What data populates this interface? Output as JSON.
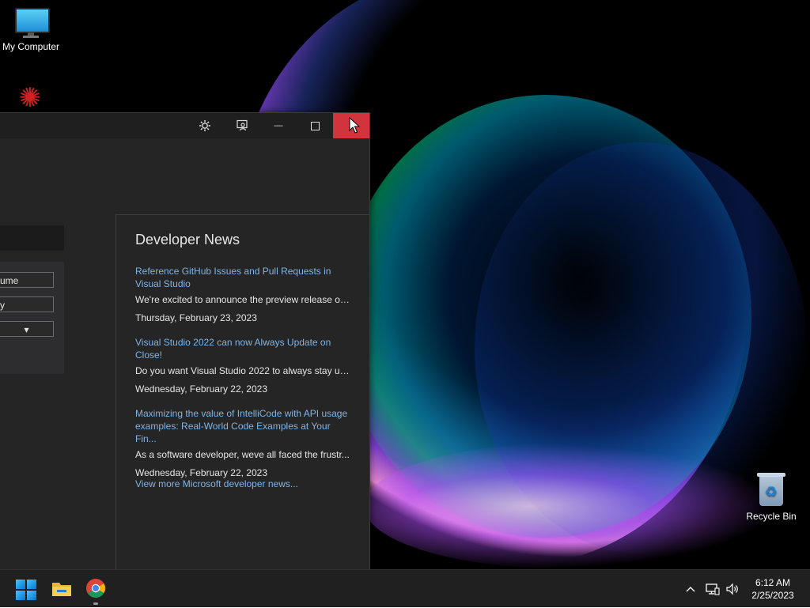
{
  "desktop": {
    "icons": [
      {
        "label": "My Computer"
      },
      {
        "label": "Recycle Bin"
      }
    ]
  },
  "window": {
    "titlebar": {
      "settings_icon": "gear-icon",
      "feedback_icon": "feedback-person-icon",
      "minimize_glyph": "—",
      "maximize_glyph": "☐",
      "close_glyph": "✕"
    },
    "left_pane": {
      "fields": [
        "sume",
        "ify",
        "▾"
      ]
    },
    "news": {
      "title": "Developer News",
      "items": [
        {
          "link": "Reference GitHub Issues and Pull Requests in Visual Studio",
          "snippet": "We're excited to announce the preview release of...",
          "date": "Thursday, February 23, 2023"
        },
        {
          "link": "Visual Studio 2022 can now Always Update on Close!",
          "snippet": "Do you want Visual Studio 2022 to always stay up...",
          "date": "Wednesday, February 22, 2023"
        },
        {
          "link": "Maximizing the value of IntelliCode with API usage examples: Real-World Code Examples at Your Fin...",
          "snippet": "As a software developer, weve all faced the frustr...",
          "date": "Wednesday, February 22, 2023"
        }
      ],
      "more_link": "View more Microsoft developer news..."
    }
  },
  "taskbar": {
    "tray": {
      "chevron": "^",
      "network_icon": "network-icon",
      "volume_icon": "volume-icon"
    },
    "clock": {
      "time": "6:12 AM",
      "date": "2/25/2023"
    }
  },
  "colors": {
    "close_button": "#d1343b",
    "link": "#7fb4e6",
    "window_bg": "#252526",
    "taskbar_bg": "#202020"
  }
}
